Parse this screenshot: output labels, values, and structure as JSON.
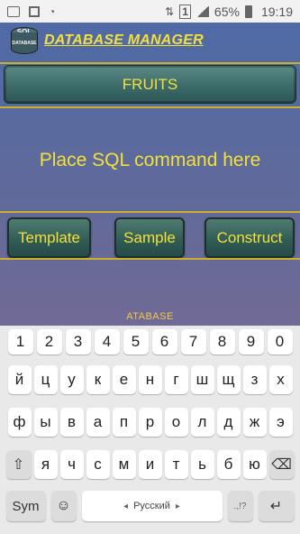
{
  "status_bar": {
    "battery_percent": "65%",
    "time": "19:19",
    "sim_slot": "1"
  },
  "app": {
    "title": "DATABASE MANAGER",
    "logo": {
      "top_text": "SQL",
      "body_text": "DATABASE"
    },
    "database_button": "FRUITS",
    "sql_placeholder": "Place SQL command here",
    "buttons": {
      "template": "Template",
      "sample": "Sample",
      "construct": "Construct"
    }
  },
  "keyboard": {
    "suggestion": "ATABASE",
    "row_numbers": [
      "1",
      "2",
      "3",
      "4",
      "5",
      "6",
      "7",
      "8",
      "9",
      "0"
    ],
    "row1": [
      "й",
      "ц",
      "у",
      "к",
      "е",
      "н",
      "г",
      "ш",
      "щ",
      "з",
      "х"
    ],
    "row2": [
      "ф",
      "ы",
      "в",
      "а",
      "п",
      "р",
      "о",
      "л",
      "д",
      "ж",
      "э"
    ],
    "row3": [
      "я",
      "ч",
      "с",
      "м",
      "и",
      "т",
      "ь",
      "б",
      "ю"
    ],
    "sym_label": "Sym",
    "space_label": "Русский",
    "punct_label": ".,!?",
    "shift_icon": "shift-icon",
    "backspace_icon": "backspace-icon",
    "enter_icon": "enter-icon",
    "emoji_icon": "emoji-icon"
  }
}
